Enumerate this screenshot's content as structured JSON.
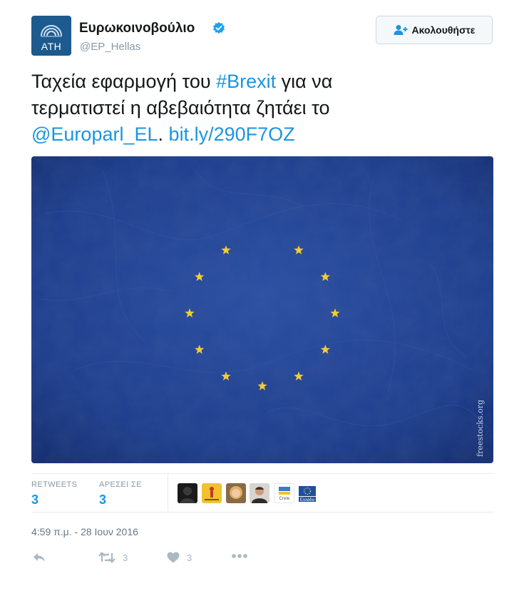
{
  "author": {
    "avatar_code": "ATH",
    "name": "Ευρωκοινοβούλιο",
    "handle": "@EP_Hellas",
    "verified": true
  },
  "follow_button": {
    "label": "Ακολουθήστε"
  },
  "tweet": {
    "text_line1_pre": "Ταχεία εφαρμογή του ",
    "hashtag": "#Brexit",
    "text_line1_post": " για να",
    "text_line2": "τερματιστεί η αβεβαιότητα ζητάει το",
    "mention": "@Europarl_EL",
    "mention_after": ".",
    "link": "bit.ly/290F7OZ"
  },
  "media": {
    "watermark": "freestocks.org",
    "flag_color": "#1e3f8f",
    "star_color": "#f2cd2e",
    "stars_visible": 11
  },
  "stats": {
    "retweets_label": "RETWEETS",
    "retweets_count": "3",
    "likes_label": "ΑΡΕΣΕΙ ΣΕ",
    "likes_count": "3"
  },
  "likers": [
    {
      "icon": "dark-silhouette-avatar"
    },
    {
      "icon": "yellow-poster-avatar"
    },
    {
      "icon": "blonde-woman-avatar"
    },
    {
      "icon": "man-portrait-avatar"
    },
    {
      "icon": "crete-logo-avatar",
      "text": "Crete"
    },
    {
      "icon": "eu-flag-avatar",
      "text": "Ελλάδα"
    }
  ],
  "timestamp": "4:59 π.μ. - 28 Ιουν 2016",
  "actions": {
    "retweet_count": "3",
    "like_count": "3"
  },
  "colors": {
    "link": "#1b95e0",
    "muted": "#8899a6",
    "action": "#aab8c2"
  }
}
